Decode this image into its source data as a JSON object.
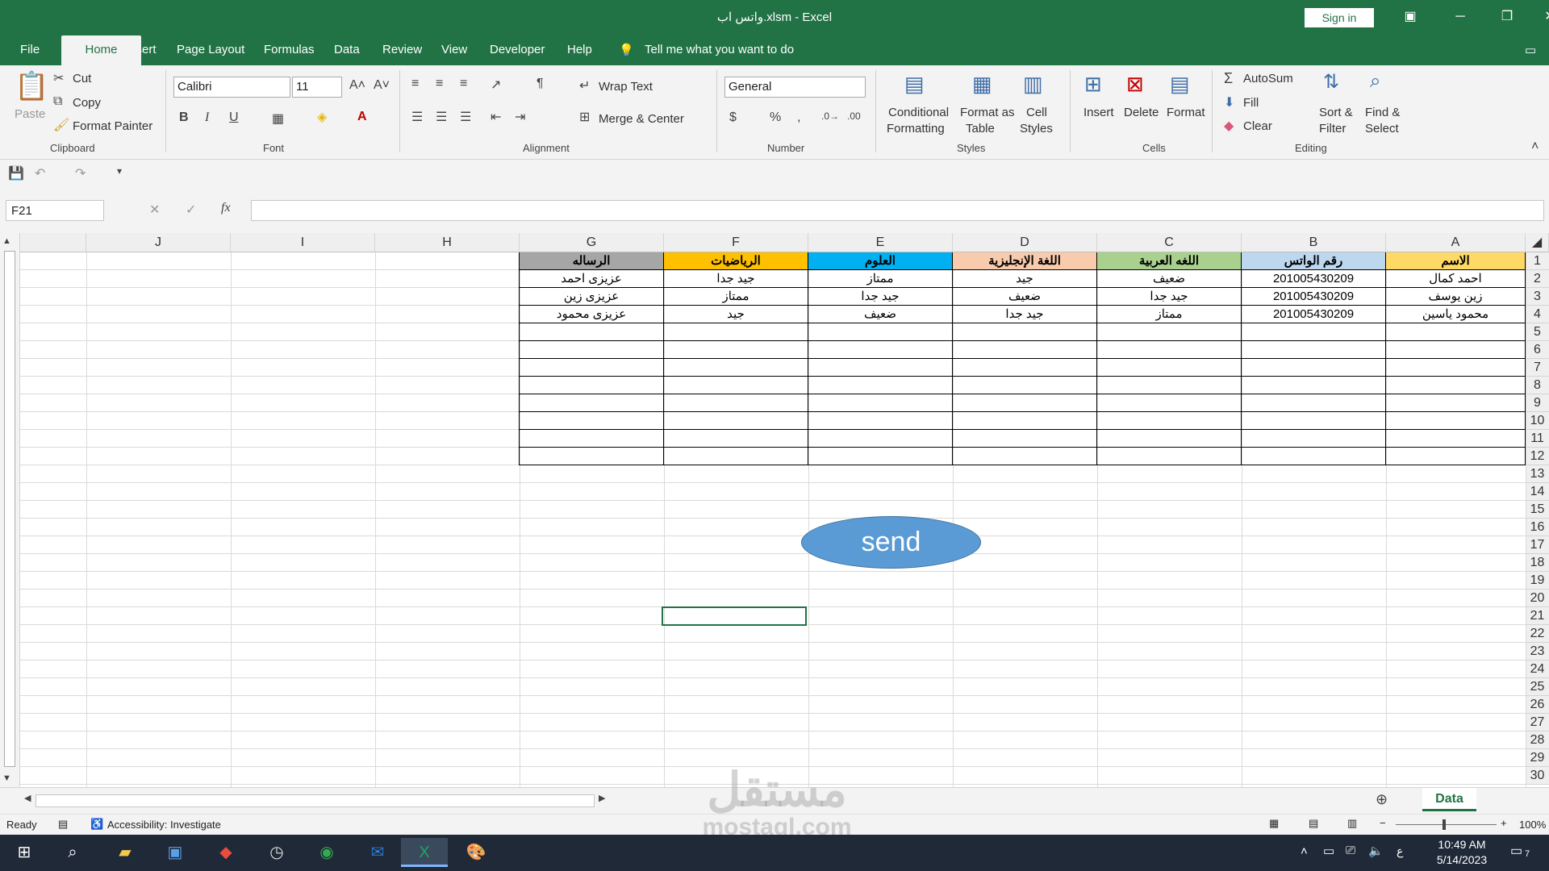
{
  "window": {
    "title": "واتس اب.xlsm  -  Excel",
    "sign_in": "Sign in"
  },
  "tabs": [
    "File",
    "Home",
    "Insert",
    "Page Layout",
    "Formulas",
    "Data",
    "Review",
    "View",
    "Developer",
    "Help"
  ],
  "tell_me": "Tell me what you want to do",
  "ribbon": {
    "clipboard": {
      "paste": "Paste",
      "cut": "Cut",
      "copy": "Copy",
      "format_painter": "Format Painter",
      "label": "Clipboard"
    },
    "font": {
      "name": "Calibri",
      "size": "11",
      "label": "Font"
    },
    "alignment": {
      "wrap_text": "Wrap Text",
      "merge_center": "Merge & Center",
      "label": "Alignment"
    },
    "number": {
      "format": "General",
      "label": "Number"
    },
    "styles": {
      "conditional_1": "Conditional",
      "conditional_2": "Formatting",
      "format_table_1": "Format as",
      "format_table_2": "Table",
      "cell_styles_1": "Cell",
      "cell_styles_2": "Styles",
      "label": "Styles"
    },
    "cells": {
      "insert": "Insert",
      "delete": "Delete",
      "format": "Format",
      "label": "Cells"
    },
    "editing": {
      "autosum": "AutoSum",
      "fill": "Fill",
      "clear": "Clear",
      "sort_1": "Sort &",
      "sort_2": "Filter",
      "find_1": "Find &",
      "find_2": "Select",
      "label": "Editing"
    }
  },
  "formula_bar": {
    "name_box": "F21",
    "fx": "fx",
    "content": ""
  },
  "columns": [
    "J",
    "I",
    "H",
    "G",
    "F",
    "E",
    "D",
    "C",
    "B",
    "A"
  ],
  "rows": [
    "1",
    "2",
    "3",
    "4",
    "5",
    "6",
    "7",
    "8",
    "9",
    "10",
    "11",
    "12",
    "13",
    "14",
    "15",
    "16",
    "17",
    "18",
    "19",
    "20",
    "21",
    "22",
    "23",
    "24",
    "25",
    "26",
    "27",
    "28",
    "29",
    "30"
  ],
  "headers": {
    "A": "الاسم",
    "B": "رقم الواتس",
    "C": "اللغه العربية",
    "D": "اللغة الإنجليزية",
    "E": "العلوم",
    "F": "الرياضيات",
    "G": "الرساله"
  },
  "header_colors": {
    "A": "#ffd966",
    "B": "#bdd7ee",
    "C": "#a9d08e",
    "D": "#f8cbad",
    "E": "#00b0f0",
    "F": "#ffc000",
    "G": "#a6a6a6"
  },
  "data_rows": [
    {
      "A": "احمد كمال",
      "B": "201005430209",
      "C": "ضعيف",
      "D": "جيد",
      "E": "ممتاز",
      "F": "جيد جدا",
      "G": "عزيزى احمد"
    },
    {
      "A": "زين يوسف",
      "B": "201005430209",
      "C": "جيد جدا",
      "D": "ضعيف",
      "E": "جيد جدا",
      "F": "ممتاز",
      "G": "عزيزى زين"
    },
    {
      "A": "محمود ياسين",
      "B": "201005430209",
      "C": "ممتاز",
      "D": "جيد جدا",
      "E": "ضعيف",
      "F": "جيد",
      "G": "عزيزى محمود"
    }
  ],
  "send_button": "send",
  "sheet_tab": "Data",
  "status": {
    "ready": "Ready",
    "accessibility": "Accessibility: Investigate",
    "zoom": "100%"
  },
  "watermark": {
    "arabic": "مستقل",
    "latin": "mostaql.com"
  },
  "taskbar": {
    "time": "10:49 AM",
    "date": "5/14/2023",
    "lang": "ع",
    "notifications": "7"
  }
}
